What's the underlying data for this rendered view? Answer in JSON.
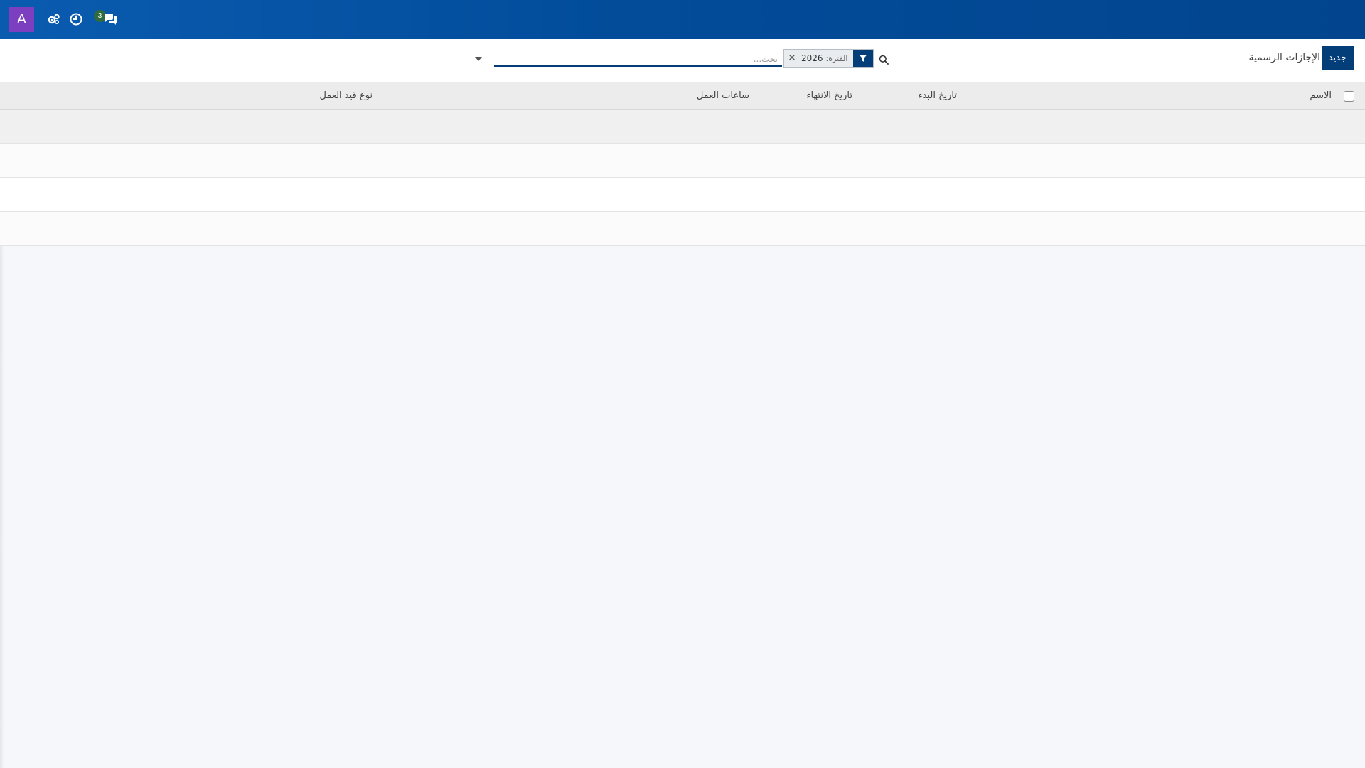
{
  "navbar": {
    "avatar_letter": "A",
    "avatar_color": "#7b3fbf",
    "icons": [
      "gears-icon",
      "clock-icon",
      "chat-icon"
    ],
    "messages_badge": "3"
  },
  "control_panel": {
    "new_label": "جديد",
    "title": "الإجازات الرسمية",
    "search": {
      "placeholder": "بحث...",
      "facet_label": "الفترة:",
      "facet_value": "2026"
    }
  },
  "table": {
    "columns": [
      "الاسم",
      "تاريخ البدء",
      "تاريخ الانتهاء",
      "ساعات العمل",
      "نوع قيد العمل"
    ],
    "rows": [
      [],
      [],
      [],
      []
    ]
  },
  "colors": {
    "navbar": "#02458e",
    "primary_button": "#033e79",
    "badge": "#2f6b3d"
  }
}
